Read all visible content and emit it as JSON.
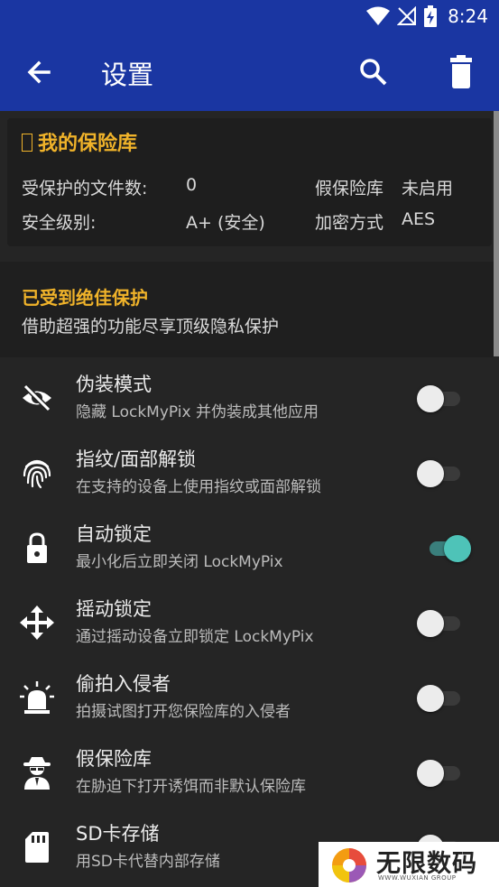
{
  "status": {
    "time": "8:24",
    "icons": [
      "wifi-icon",
      "no-signal-icon",
      "battery-charging-icon"
    ]
  },
  "appbar": {
    "title": "设置",
    "icons": [
      "back-arrow-icon",
      "search-icon",
      "trash-icon"
    ]
  },
  "vault": {
    "title": "我的保险库",
    "files_label": "受保护的文件数:",
    "files_value": "0",
    "fake_label": "假保险库",
    "fake_value": "未启用",
    "level_label": "安全级别:",
    "level_value": "A+ (安全)",
    "enc_label": "加密方式",
    "enc_value": "AES"
  },
  "promo": {
    "title": "已受到绝佳保护",
    "subtitle": "借助超强的功能尽享顶级隐私保护"
  },
  "settings": [
    {
      "title": "伪装模式",
      "subtitle": "隐藏 LockMyPix 并伪装成其他应用",
      "icon": "eye-off-icon",
      "on": false
    },
    {
      "title": "指纹/面部解锁",
      "subtitle": "在支持的设备上使用指纹或面部解锁",
      "icon": "fingerprint-icon",
      "on": false
    },
    {
      "title": "自动锁定",
      "subtitle": "最小化后立即关闭 LockMyPix",
      "icon": "lock-icon",
      "on": true
    },
    {
      "title": "摇动锁定",
      "subtitle": "通过摇动设备立即锁定 LockMyPix",
      "icon": "move-arrows-icon",
      "on": false
    },
    {
      "title": "偷拍入侵者",
      "subtitle": "拍摄试图打开您保险库的入侵者",
      "icon": "alarm-light-icon",
      "on": false
    },
    {
      "title": "假保险库",
      "subtitle": "在胁迫下打开诱饵而非默认保险库",
      "icon": "spy-icon",
      "on": false
    },
    {
      "title": "SD卡存储",
      "subtitle": "用SD卡代替内部存储",
      "icon": "sd-card-icon",
      "on": false
    }
  ],
  "watermark": {
    "text": "无限数码",
    "sub": "WWW.WUXIAN GROUP"
  },
  "colors": {
    "appbar": "#1a36a2",
    "accent": "#f0b32a",
    "switch_on": "#4ec3b8",
    "background": "#252525"
  }
}
